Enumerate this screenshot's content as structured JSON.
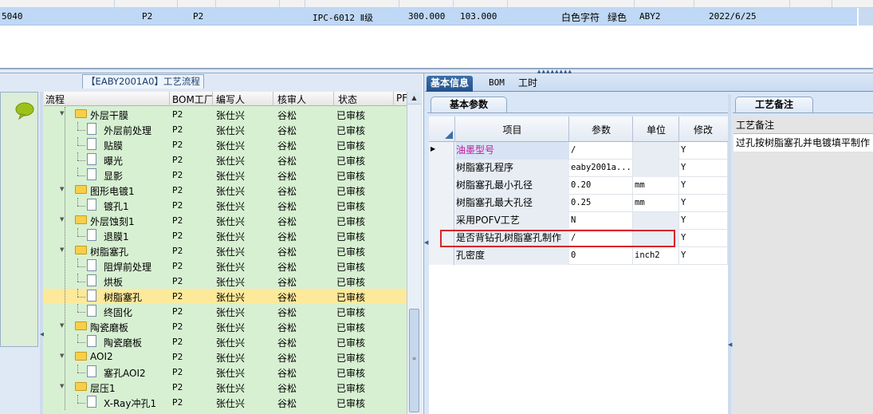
{
  "top_grid": {
    "row": {
      "code": "5040",
      "factory1": "P2",
      "factory2": "P2",
      "model": "IPC-6012 Ⅱ级",
      "value1": "300.000",
      "value2": "103.000",
      "char_color": "白色字符",
      "color": "绿色",
      "customer": "ABY2",
      "date": "2022/6/25"
    }
  },
  "flow_panel": {
    "title": "【EABY2001A0】工艺流程",
    "columns": [
      "流程",
      "BOM工厂",
      "编写人",
      "核审人",
      "状态",
      "PF"
    ],
    "rows": [
      {
        "name": "外层干膜",
        "level": 0,
        "factory": "P2",
        "writer": "张仕兴",
        "reviewer": "谷松",
        "status": "已审核"
      },
      {
        "name": "外层前处理",
        "level": 1,
        "factory": "P2",
        "writer": "张仕兴",
        "reviewer": "谷松",
        "status": "已审核"
      },
      {
        "name": "贴膜",
        "level": 1,
        "factory": "P2",
        "writer": "张仕兴",
        "reviewer": "谷松",
        "status": "已审核"
      },
      {
        "name": "曝光",
        "level": 1,
        "factory": "P2",
        "writer": "张仕兴",
        "reviewer": "谷松",
        "status": "已审核"
      },
      {
        "name": "显影",
        "level": 1,
        "factory": "P2",
        "writer": "张仕兴",
        "reviewer": "谷松",
        "status": "已审核"
      },
      {
        "name": "图形电镀1",
        "level": 0,
        "factory": "P2",
        "writer": "张仕兴",
        "reviewer": "谷松",
        "status": "已审核"
      },
      {
        "name": "镀孔1",
        "level": 1,
        "factory": "P2",
        "writer": "张仕兴",
        "reviewer": "谷松",
        "status": "已审核"
      },
      {
        "name": "外层蚀刻1",
        "level": 0,
        "factory": "P2",
        "writer": "张仕兴",
        "reviewer": "谷松",
        "status": "已审核"
      },
      {
        "name": "退膜1",
        "level": 1,
        "factory": "P2",
        "writer": "张仕兴",
        "reviewer": "谷松",
        "status": "已审核"
      },
      {
        "name": "树脂塞孔",
        "level": 0,
        "factory": "P2",
        "writer": "张仕兴",
        "reviewer": "谷松",
        "status": "已审核"
      },
      {
        "name": "阻焊前处理",
        "level": 1,
        "factory": "P2",
        "writer": "张仕兴",
        "reviewer": "谷松",
        "status": "已审核"
      },
      {
        "name": "烘板",
        "level": 1,
        "factory": "P2",
        "writer": "张仕兴",
        "reviewer": "谷松",
        "status": "已审核"
      },
      {
        "name": "树脂塞孔",
        "level": 1,
        "factory": "P2",
        "writer": "张仕兴",
        "reviewer": "谷松",
        "status": "已审核",
        "selected": true
      },
      {
        "name": "终固化",
        "level": 1,
        "factory": "P2",
        "writer": "张仕兴",
        "reviewer": "谷松",
        "status": "已审核"
      },
      {
        "name": "陶瓷磨板",
        "level": 0,
        "factory": "P2",
        "writer": "张仕兴",
        "reviewer": "谷松",
        "status": "已审核"
      },
      {
        "name": "陶瓷磨板",
        "level": 1,
        "factory": "P2",
        "writer": "张仕兴",
        "reviewer": "谷松",
        "status": "已审核"
      },
      {
        "name": "AOI2",
        "level": 0,
        "factory": "P2",
        "writer": "张仕兴",
        "reviewer": "谷松",
        "status": "已审核"
      },
      {
        "name": "塞孔AOI2",
        "level": 1,
        "factory": "P2",
        "writer": "张仕兴",
        "reviewer": "谷松",
        "status": "已审核"
      },
      {
        "name": "层压1",
        "level": 0,
        "factory": "P2",
        "writer": "张仕兴",
        "reviewer": "谷松",
        "status": "已审核"
      },
      {
        "name": "X-Ray冲孔1",
        "level": 1,
        "factory": "P2",
        "writer": "张仕兴",
        "reviewer": "谷松",
        "status": "已审核"
      }
    ]
  },
  "right_tabs": [
    "基本信息",
    "BOM",
    "工时"
  ],
  "params": {
    "tab_label": "基本参数",
    "columns": [
      "项目",
      "参数",
      "单位",
      "修改"
    ],
    "rows": [
      {
        "item": "油墨型号",
        "value": "/",
        "unit": "",
        "modify": "Y",
        "current": true
      },
      {
        "item": "树脂塞孔程序",
        "value": "eaby2001a...",
        "unit": "",
        "modify": "Y"
      },
      {
        "item": "树脂塞孔最小孔径",
        "value": "0.20",
        "unit": "mm",
        "modify": "Y"
      },
      {
        "item": "树脂塞孔最大孔径",
        "value": "0.25",
        "unit": "mm",
        "modify": "Y"
      },
      {
        "item": "采用POFV工艺",
        "value": "N",
        "unit": "",
        "modify": "Y"
      },
      {
        "item": "是否背钻孔树脂塞孔制作",
        "value": "/",
        "unit": "",
        "modify": "Y"
      },
      {
        "item": "孔密度",
        "value": "0",
        "unit": "inch2",
        "modify": "Y"
      }
    ]
  },
  "remarks": {
    "tab_label": "工艺备注",
    "header": "工艺备注",
    "text": "过孔按树脂塞孔并电镀填平制作"
  },
  "colors": {
    "tree_bg": "#d7f0d2",
    "selected_row": "#fde99a",
    "highlight_box": "#d8262b",
    "top_row": "#bfd8f5",
    "current_item_text": "#c0169a"
  }
}
